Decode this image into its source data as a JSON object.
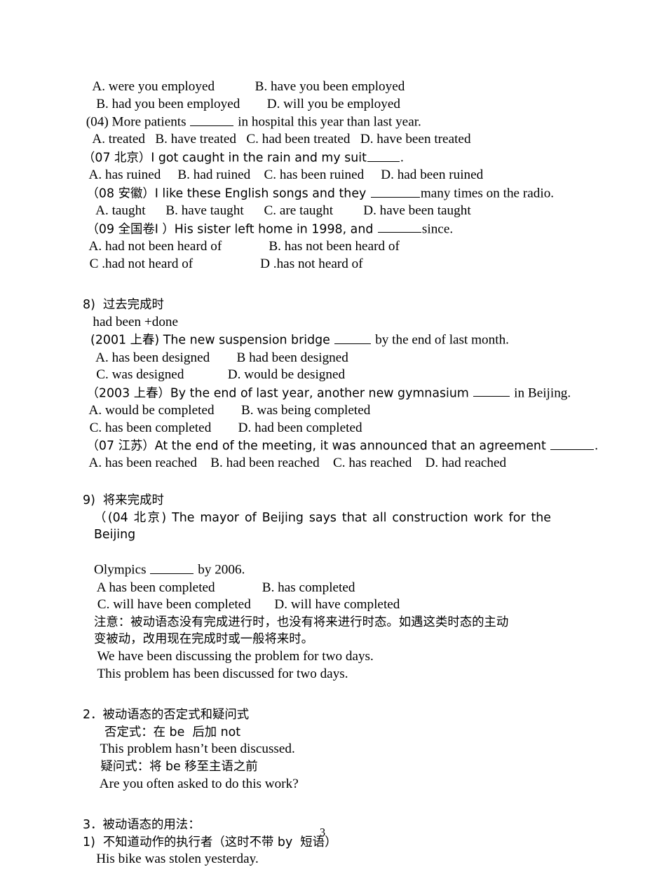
{
  "document": {
    "page_number": "3",
    "blocks": {
      "opts_employed_a": "   A. were you employed            B. have you been employed",
      "opts_employed_b": "    B. had you been employed        D. will you be employed",
      "q04_stem_pre": " (04) More patients ",
      "q04_stem_post": " in hospital this year than last year.",
      "q04_options": "   A. treated   B. have treated   C. had been treated   D. have been treated",
      "q07bj_stem_pre": "（07 北京）I got caught in the rain and my suit",
      "q07bj_stem_post": ".",
      "q07bj_options": "  A. has ruined     B. had ruined    C. has been ruined     D. had been ruined",
      "q08ah_stem_pre": " （08 安徽）I like these English songs and they ",
      "q08ah_stem_post": "many times on the radio.",
      "q08ah_options": "    A. taught      B. have taught      C. are taught         D. have been taught",
      "q09gk_stem_pre": " （09 全国卷Ⅰ ）His sister left home in 1998, and ",
      "q09gk_stem_post": "since.",
      "q09gk_opt_ab": "  A. had not been heard of              B. has not been heard of",
      "q09gk_opt_cd": "  C .had not heard of                    D .has not heard of",
      "sec8_heading": "8)  过去完成时",
      "sec8_formula": "   had been +done",
      "q2001_stem_pre": "  (2001 上春) The new suspension bridge ",
      "q2001_stem_post": " by the end of last month.",
      "q2001_opt_ab": "    A. has been designed        B had been designed",
      "q2001_opt_cd": "    C. was designed             D. would be designed",
      "q2003_stem_pre": " （2003 上春）By the end of last year, another new gymnasium ",
      "q2003_stem_post": " in Beijing.",
      "q2003_opt_ab": "  A. would be completed        B. was being completed",
      "q2003_opt_cd": "  C. has been completed        D. had been completed",
      "q07js_stem_pre": " （07 江苏）At the end of the meeting, it was announced that an agreement ",
      "q07js_stem_post": ".",
      "q07js_options": "  A. has been reached    B. had been reached    C. has reached    D. had reached",
      "sec9_heading": "9)  将来完成时",
      "q04bj_stem_1": "（(04 北京) The mayor of Beijing says that all construction work for the Beijing",
      "q04bj_stem_2_pre": "Olympics ",
      "q04bj_stem_2_post": " by 2006.",
      "q04bj_opt_ab": " A has been completed              B. has completed",
      "q04bj_opt_cd": " C. will have been completed       D. will have completed",
      "note_line1": "注意：被动语态没有完成进行时，也没有将来进行时态。如遇这类时态的主动",
      "note_line2": "变被动，改用现在完成时或一般将来时。",
      "note_example1": " We have been discussing the problem for two days.",
      "note_example2": " This problem has been discussed for two days.",
      "sec2_heading": "2．被动语态的否定式和疑问式",
      "sec2_negative_rule": "  否定式：在 be  后加 not",
      "sec2_negative_example": " This problem hasn’t been discussed.",
      "sec2_question_rule": " 疑问式：将 be 移至主语之前",
      "sec2_question_example": " Are you often asked to do this work?",
      "sec3_heading": "3．被动语态的用法：",
      "sec3_item1": "1)  不知道动作的执行者（这时不带 by  短语）",
      "sec3_item1_example": "    His bike was stolen yesterday."
    }
  }
}
